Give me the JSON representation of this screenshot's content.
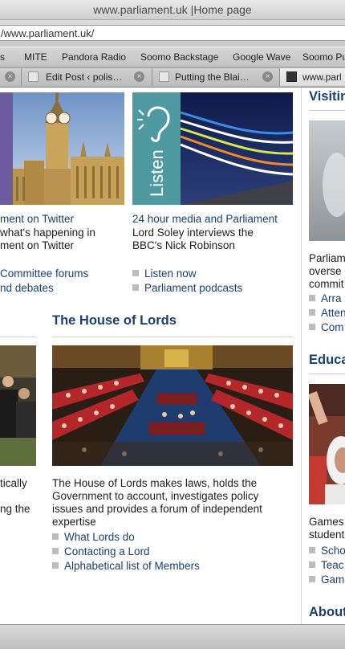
{
  "browser": {
    "title": "www.parliament.uk |Home page",
    "url": "/www.parliament.uk/",
    "bookmarks": [
      "s",
      "MITE",
      "Pandora Radio",
      "Soomo Backstage",
      "Google Wave",
      "Soomo Pu"
    ],
    "tabs": [
      {
        "label": "Edit Post ‹ polis…"
      },
      {
        "label": "Putting the Blai…"
      },
      {
        "label": "www.parl"
      }
    ]
  },
  "twitter": {
    "title": "ment on Twitter",
    "desc_line1": "what's happening in",
    "desc_line2": "ment on Twitter"
  },
  "forums": {
    "link1": "Committee forums",
    "link2": "nd debates"
  },
  "listen": {
    "image_label": "Listen",
    "title": "24 hour media and Parliament",
    "desc_line1": "Lord Soley interviews the",
    "desc_line2": "BBC's Nick Robinson",
    "links": [
      "Listen now",
      "Parliament podcasts"
    ]
  },
  "left_col": {
    "text_line1": "tically",
    "text_line2": "ng the"
  },
  "lords": {
    "heading": "The House of Lords",
    "desc_line1": "The House of Lords makes laws, holds the",
    "desc_line2": "Government to account, investigates policy",
    "desc_line3": "issues and provides a forum of independent",
    "desc_line4": "expertise",
    "links": [
      "What Lords do",
      "Contacting a Lord",
      "Alphabetical list of Members"
    ]
  },
  "visiting": {
    "heading": "Visitin",
    "desc_line1": "Parliam",
    "desc_line2": "overse",
    "desc_line3": "commit",
    "links": [
      "Arra",
      "Atten",
      "Com"
    ]
  },
  "education": {
    "heading": "Educa",
    "desc_line1": "Games",
    "desc_line2": "student",
    "links": [
      "Scho",
      "Teac",
      "Gam"
    ]
  },
  "about": {
    "heading": "About"
  },
  "colors": {
    "link": "#1b3f6e",
    "listen_teal": "#4e9aa0"
  }
}
